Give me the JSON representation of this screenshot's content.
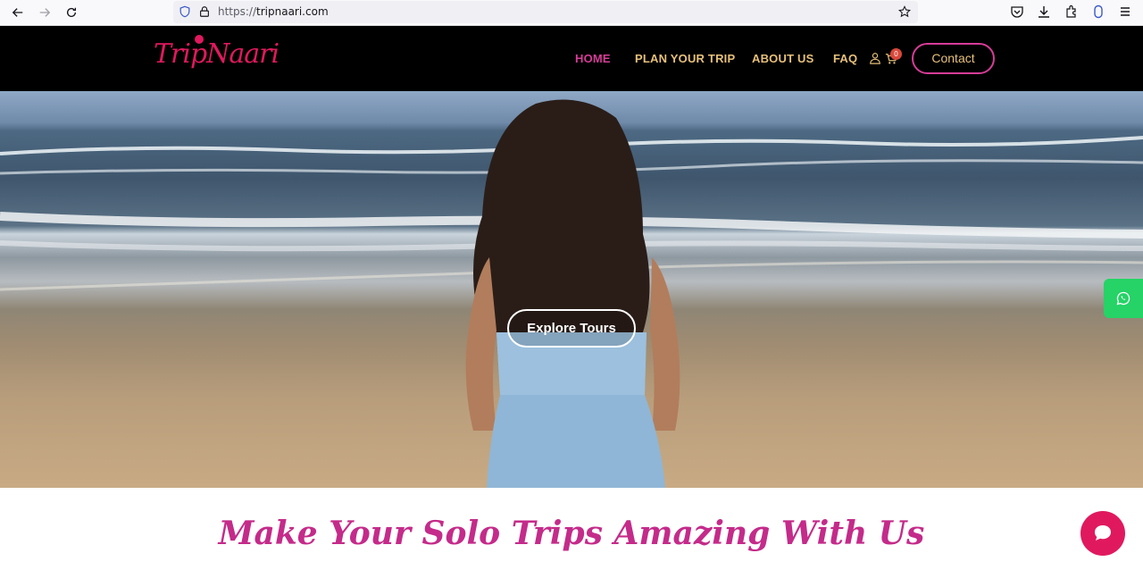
{
  "browser": {
    "url_scheme": "https://",
    "url_host": "tripnaari.com",
    "icons": [
      "back-icon",
      "forward-icon",
      "reload-icon",
      "shield-icon",
      "lock-icon",
      "bookmark-star-icon",
      "pocket-icon",
      "download-icon",
      "extensions-icon",
      "account-icon",
      "menu-icon"
    ]
  },
  "header": {
    "logo_text": "TripNaari",
    "nav": [
      {
        "label": "HOME",
        "active": true
      },
      {
        "label": "PLAN YOUR TRIP",
        "active": false
      },
      {
        "label": "ABOUT US",
        "active": false
      },
      {
        "label": "FAQ",
        "active": false
      }
    ],
    "cart_count": "0",
    "contact_label": "Contact"
  },
  "hero": {
    "cta_label": "Explore Tours"
  },
  "section": {
    "headline": "Make Your Solo Trips Amazing With Us"
  },
  "colors": {
    "brand_pink": "#e0195e",
    "nav_gold": "#e6c07a",
    "nav_active": "#d63c98",
    "whatsapp_green": "#25d366"
  }
}
